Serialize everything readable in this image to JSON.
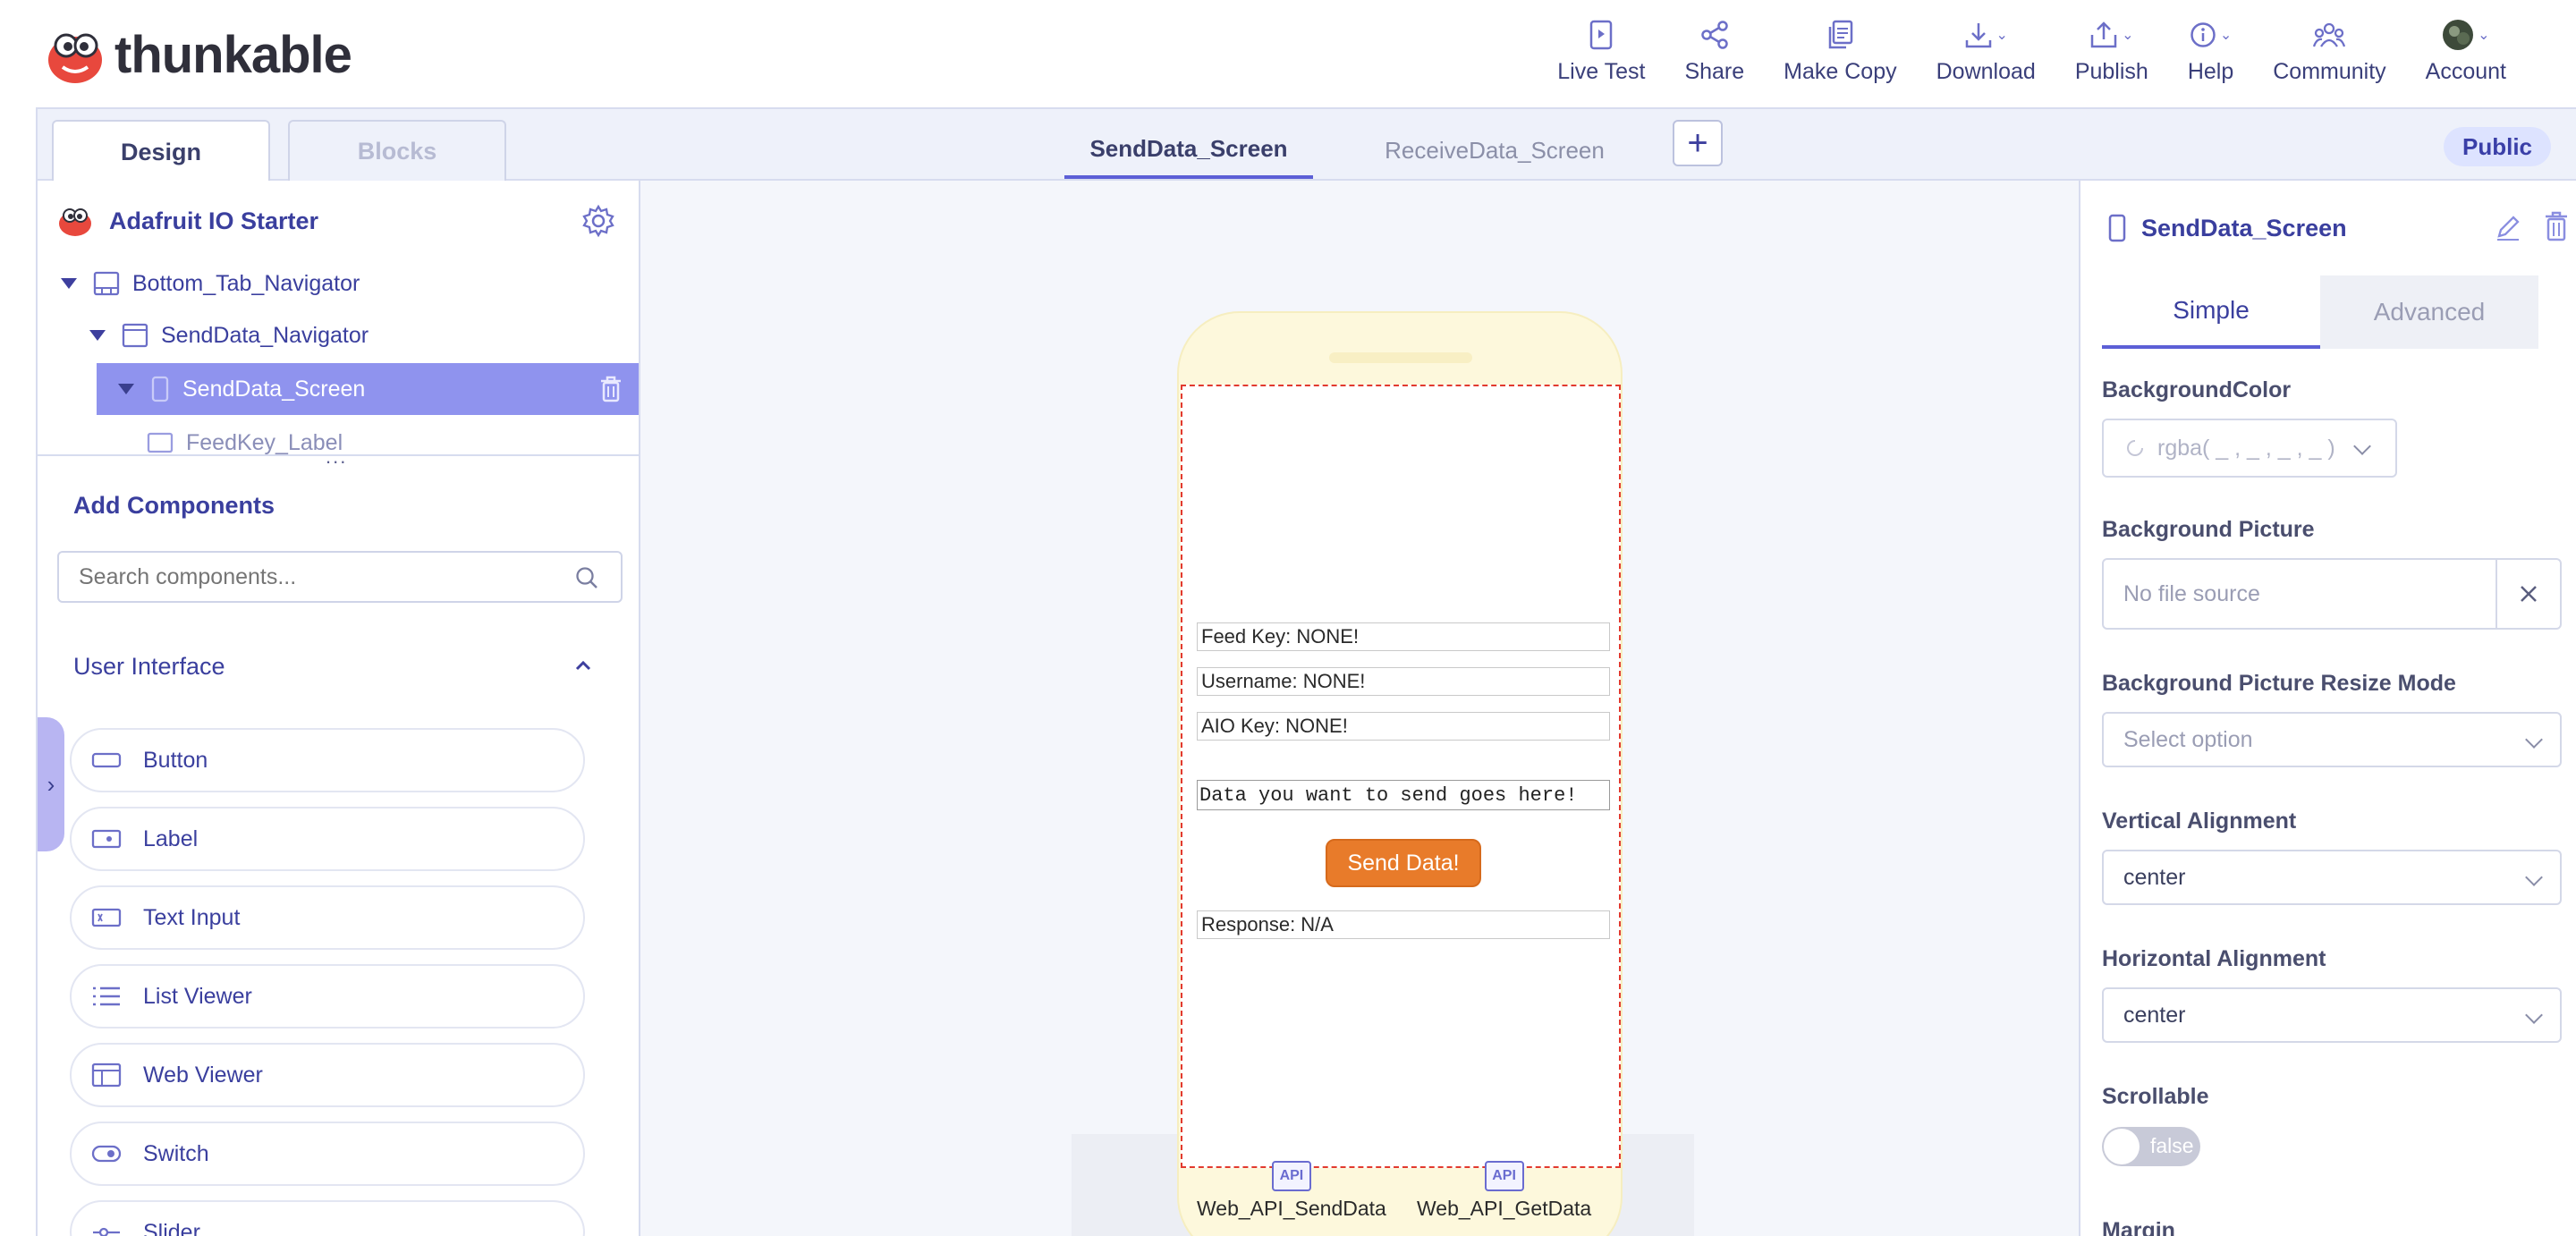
{
  "app": {
    "logo_text": "thunkable",
    "nav": [
      {
        "name": "live-test",
        "label": "Live Test",
        "icon": "live-test-icon",
        "caret": false
      },
      {
        "name": "share",
        "label": "Share",
        "icon": "share-icon",
        "caret": false
      },
      {
        "name": "make-copy",
        "label": "Make Copy",
        "icon": "copy-icon",
        "caret": false
      },
      {
        "name": "download",
        "label": "Download",
        "icon": "download-icon",
        "caret": true
      },
      {
        "name": "publish",
        "label": "Publish",
        "icon": "publish-icon",
        "caret": true
      },
      {
        "name": "help",
        "label": "Help",
        "icon": "info-icon",
        "caret": true
      },
      {
        "name": "community",
        "label": "Community",
        "icon": "community-icon",
        "caret": false
      },
      {
        "name": "account",
        "label": "Account",
        "icon": "avatar-icon",
        "caret": true
      }
    ]
  },
  "tabs": {
    "design": "Design",
    "blocks": "Blocks",
    "screens": [
      "SendData_Screen",
      "ReceiveData_Screen"
    ],
    "add_symbol": "+",
    "public_badge": "Public"
  },
  "tree": {
    "project": "Adafruit IO Starter",
    "items": [
      "Bottom_Tab_Navigator",
      "SendData_Navigator",
      "SendData_Screen",
      "FeedKey_Label"
    ],
    "drag_handle": "..."
  },
  "components": {
    "title": "Add Components",
    "search_placeholder": "Search components...",
    "section": "User Interface",
    "items": [
      "Button",
      "Label",
      "Text Input",
      "List Viewer",
      "Web Viewer",
      "Switch",
      "Slider"
    ]
  },
  "phone": {
    "feed_key": "Feed Key: NONE!",
    "username": "Username: NONE!",
    "aio_key": "AIO Key: NONE!",
    "data_input": "Data you want to send goes here!",
    "send_button": "Send Data!",
    "response": "Response: N/A",
    "api_icon_text": "API",
    "api_send": "Web_API_SendData",
    "api_get": "Web_API_GetData"
  },
  "properties": {
    "title": "SendData_Screen",
    "tab_simple": "Simple",
    "tab_advanced": "Advanced",
    "background_color_label": "BackgroundColor",
    "background_color_value": "rgba( _ , _ , _ , _ )",
    "background_picture_label": "Background Picture",
    "background_picture_value": "No file source",
    "resize_mode_label": "Background Picture Resize Mode",
    "resize_mode_value": "Select option",
    "vertical_alignment_label": "Vertical Alignment",
    "vertical_alignment_value": "center",
    "horizontal_alignment_label": "Horizontal Alignment",
    "horizontal_alignment_value": "center",
    "scrollable_label": "Scrollable",
    "scrollable_value": "false",
    "margin_label": "Margin"
  },
  "colors": {
    "accent": "#5c5fd6",
    "selected_row": "#8f93ee",
    "button_orange": "#e87b2a",
    "phone_body": "#fdf8dc",
    "dashed_border": "#e23a2f"
  }
}
